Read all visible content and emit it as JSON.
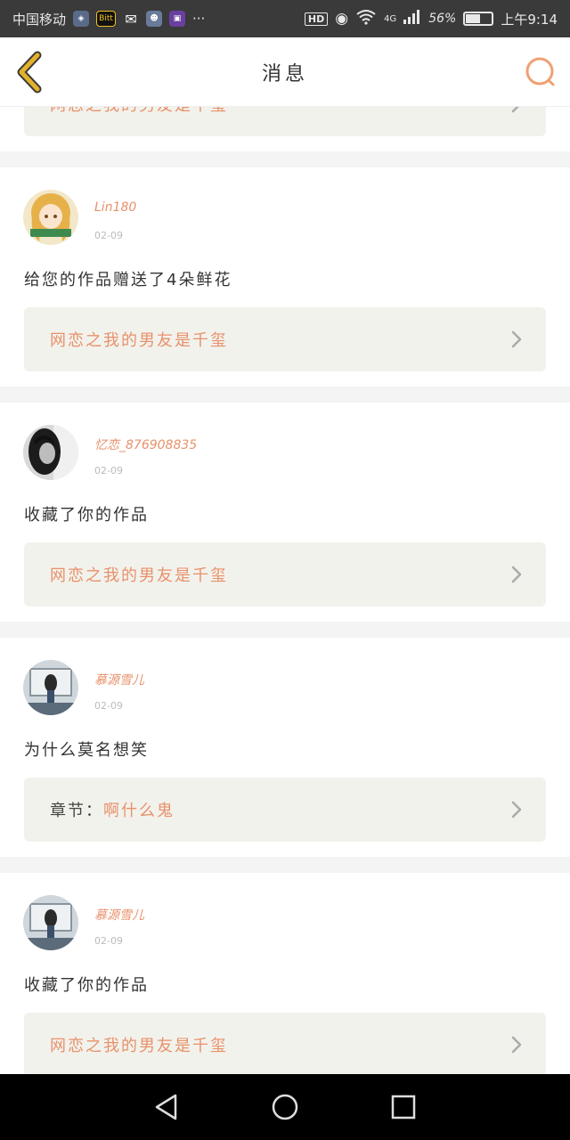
{
  "status_bar": {
    "carrier": "中国移动",
    "app_badge": "Bitt",
    "more": "···",
    "hd": "HD",
    "network": "4G",
    "battery": "56%",
    "battery_level": 0.56,
    "time": "上午9:14"
  },
  "header": {
    "title": "消息"
  },
  "notifications": [
    {
      "username": "",
      "date": "",
      "message": "",
      "link_prefix": "",
      "link_text": "网恋之我的男友是千玺"
    },
    {
      "username": "Lin180",
      "date": "02-09",
      "message": "给您的作品赠送了4朵鲜花",
      "link_prefix": "",
      "link_text": "网恋之我的男友是千玺"
    },
    {
      "username": "忆恋_876908835",
      "date": "02-09",
      "message": "收藏了你的作品",
      "link_prefix": "",
      "link_text": "网恋之我的男友是千玺"
    },
    {
      "username": "慕源雪儿",
      "date": "02-09",
      "message": "为什么莫名想笑",
      "link_prefix": "章节：",
      "link_text": "啊什么鬼"
    },
    {
      "username": "慕源雪儿",
      "date": "02-09",
      "message": "收藏了你的作品",
      "link_prefix": "",
      "link_text": "网恋之我的男友是千玺"
    }
  ],
  "colors": {
    "accent": "#e8916b",
    "back_arrow": "#e3b12b",
    "link_bg": "#f2f2ec"
  }
}
